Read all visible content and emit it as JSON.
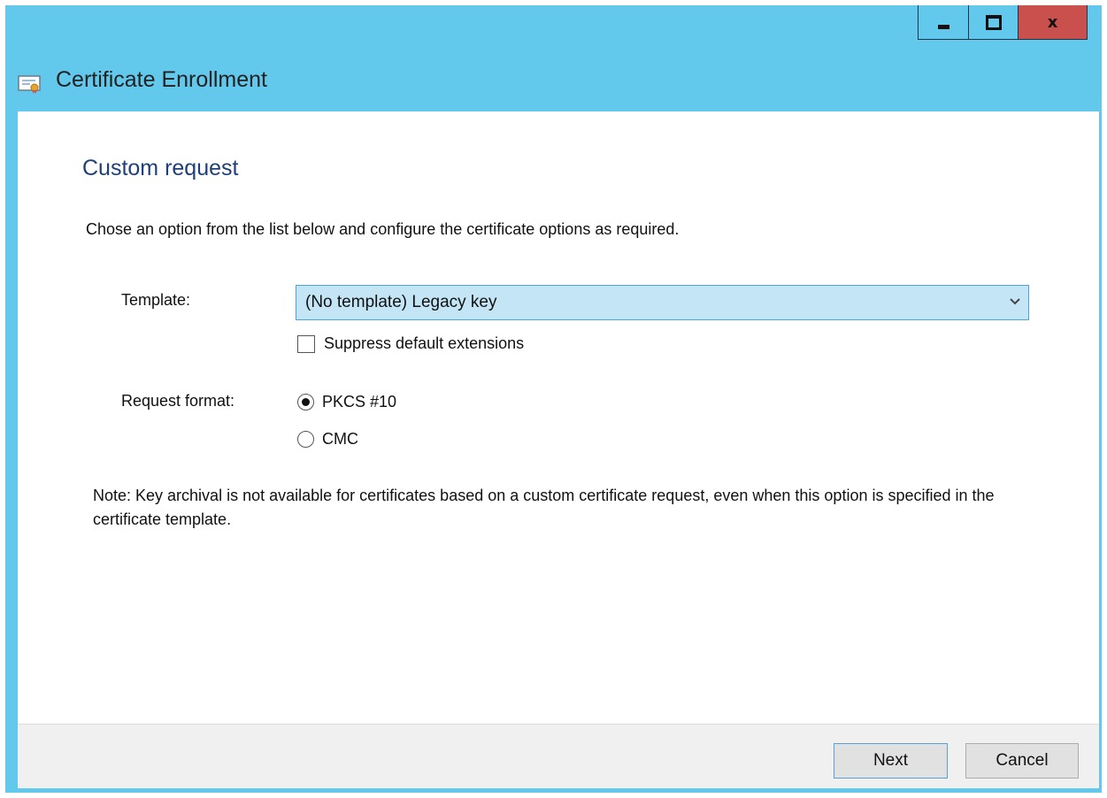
{
  "window": {
    "title": "Certificate Enrollment",
    "controls": {
      "minimize": "minimize",
      "maximize": "maximize",
      "close": "x"
    }
  },
  "page": {
    "title": "Custom request",
    "instructions": "Chose an option from the list below and configure the certificate options as required."
  },
  "template": {
    "label": "Template:",
    "selected": "(No template) Legacy key",
    "suppress_label": "Suppress default extensions",
    "suppress_checked": false
  },
  "request_format": {
    "label": "Request format:",
    "options": [
      {
        "label": "PKCS #10",
        "selected": true
      },
      {
        "label": "CMC",
        "selected": false
      }
    ]
  },
  "note": "Note: Key archival is not available for certificates based on a custom certificate request, even when this option is specified in the certificate template.",
  "footer": {
    "next_label": "Next",
    "cancel_label": "Cancel"
  },
  "icons": {
    "app": "certificate-icon",
    "dropdown": "chevron-down-icon"
  },
  "colors": {
    "titlebar": "#62c8ec",
    "close_button": "#c9504d",
    "heading": "#1e3f78",
    "dropdown_fill": "#c4e5f6"
  }
}
